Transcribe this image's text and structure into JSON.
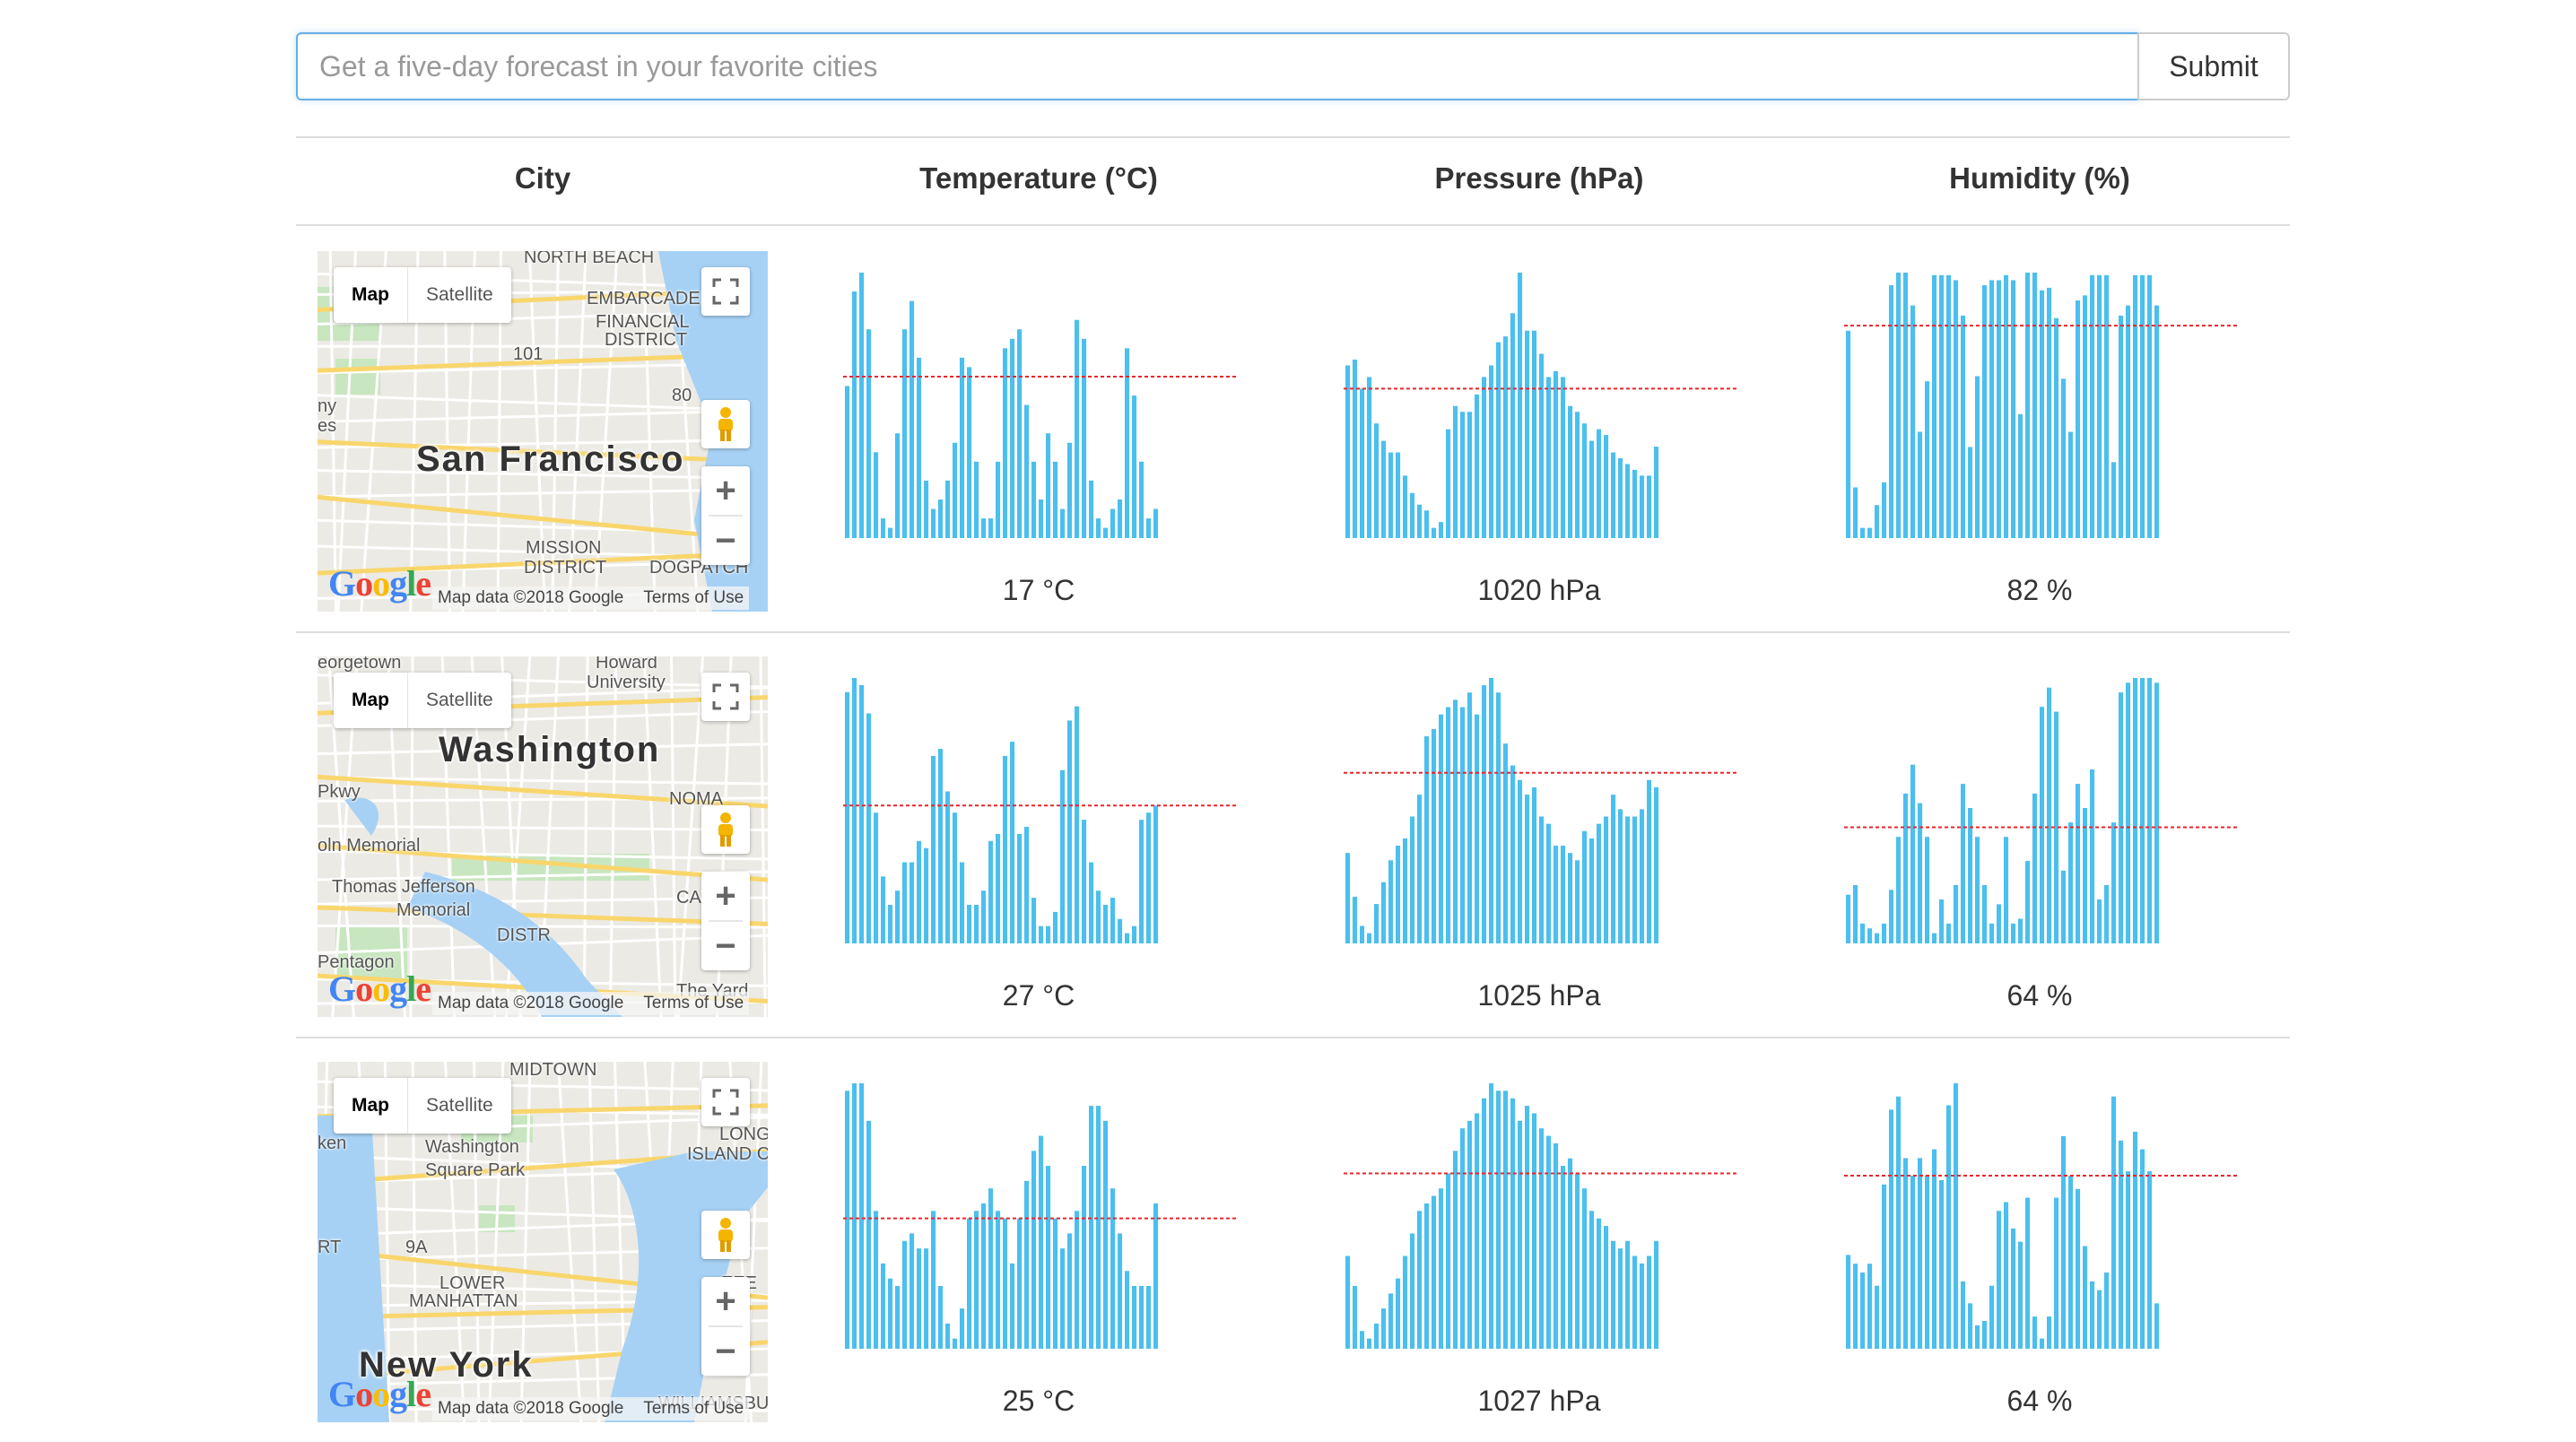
{
  "search": {
    "placeholder": "Get a five-day forecast in your favorite cities",
    "submit_label": "Submit"
  },
  "table": {
    "headers": [
      "City",
      "Temperature (°C)",
      "Pressure (hPa)",
      "Humidity (%)"
    ]
  },
  "map_controls": {
    "map_label": "Map",
    "satellite_label": "Satellite",
    "google_label": "Google",
    "map_data": "Map data ©2018 Google",
    "terms": "Terms of Use",
    "zoom_in": "+",
    "zoom_out": "−"
  },
  "colors": {
    "bar": "#4bbfee",
    "mean_line": "#e8262b",
    "divider": "#dddddd",
    "input_focus": "#66afe9"
  },
  "rows": [
    {
      "city": "San Francisco",
      "map_labels": [
        "NORTH BEACH",
        "EMBARCADERO",
        "FINANCIAL",
        "DISTRICT",
        "101",
        "80",
        "MISSION",
        "DISTRICT",
        "DOGPATCH",
        "ny",
        "es"
      ],
      "temperature": {
        "label": "17 °C",
        "mean": 17,
        "values": [
          16,
          26,
          28,
          22,
          9,
          2,
          1,
          11,
          22,
          25,
          19,
          6,
          3,
          4,
          6,
          10,
          19,
          18,
          8,
          2,
          2,
          8,
          20,
          21,
          22,
          14,
          8,
          4,
          11,
          8,
          3,
          10,
          23,
          21,
          6,
          2,
          1,
          3,
          4,
          20,
          15,
          8,
          2,
          3
        ]
      },
      "pressure": {
        "label": "1020 hPa",
        "mean": 1020,
        "values": [
          1024,
          1025,
          1020,
          1022,
          1014,
          1011,
          1009,
          1009,
          1005,
          1002,
          1000,
          999,
          996,
          997,
          1013,
          1017,
          1016,
          1016,
          1019,
          1022,
          1024,
          1028,
          1029,
          1033,
          1040,
          1030,
          1030,
          1026,
          1022,
          1023,
          1022,
          1017,
          1016,
          1014,
          1011,
          1013,
          1012,
          1009,
          1008,
          1007,
          1006,
          1005,
          1005,
          1010
        ]
      },
      "humidity": {
        "label": "82 %",
        "mean": 82,
        "values": [
          80,
          18,
          2,
          2,
          11,
          20,
          98,
          103,
          103,
          90,
          40,
          60,
          102,
          102,
          102,
          100,
          86,
          34,
          62,
          98,
          100,
          100,
          102,
          100,
          47,
          103,
          103,
          96,
          97,
          85,
          61,
          40,
          92,
          94,
          102,
          102,
          102,
          28,
          86,
          90,
          102,
          102,
          102,
          90
        ]
      }
    },
    {
      "city": "Washington",
      "map_labels": [
        "eorgetown",
        "Howard",
        "University",
        "Pkwy",
        "NOMA",
        "oln Memorial",
        "Thomas Jefferson",
        "Memorial",
        "CA",
        "Pentagon",
        "DISTR",
        "The Yard"
      ],
      "temperature": {
        "label": "27 °C",
        "mean": 27,
        "values": [
          43,
          45,
          44,
          40,
          26,
          17,
          13,
          15,
          19,
          19,
          22,
          21,
          34,
          35,
          29,
          26,
          19,
          13,
          13,
          15,
          22,
          23,
          34,
          36,
          23,
          24,
          14,
          10,
          10,
          12,
          32,
          39,
          41,
          25,
          19,
          15,
          13,
          14,
          11,
          9,
          10,
          25,
          26,
          27
        ]
      },
      "pressure": {
        "label": "1025 hPa",
        "mean": 1025,
        "values": [
          1014,
          1008,
          1004,
          1003,
          1007,
          1010,
          1013,
          1015,
          1016,
          1019,
          1022,
          1030,
          1031,
          1033,
          1034,
          1035,
          1034,
          1036,
          1033,
          1037,
          1038,
          1036,
          1029,
          1026,
          1024,
          1022,
          1023,
          1019,
          1018,
          1015,
          1015,
          1014,
          1013,
          1017,
          1016,
          1018,
          1019,
          1022,
          1020,
          1019,
          1019,
          1020,
          1024,
          1023
        ]
      },
      "humidity": {
        "label": "64 %",
        "mean": 64,
        "values": [
          50,
          52,
          44,
          43,
          42,
          44,
          51,
          62,
          71,
          77,
          69,
          62,
          42,
          49,
          44,
          52,
          73,
          68,
          62,
          52,
          44,
          48,
          62,
          44,
          45,
          57,
          71,
          89,
          93,
          88,
          55,
          65,
          73,
          68,
          76,
          49,
          52,
          65,
          92,
          94,
          95,
          95,
          95,
          94
        ]
      }
    },
    {
      "city": "New York",
      "map_labels": [
        "MIDTOWN",
        "Washington",
        "Square Park",
        "LONG",
        "ISLAND C",
        "9A",
        "LOWER",
        "MANHATTAN",
        "RT",
        "ken",
        "WILLIAMSBURG",
        "EEE"
      ],
      "temperature": {
        "label": "25 °C",
        "mean": 25,
        "values": [
          42,
          43,
          43,
          38,
          26,
          19,
          17,
          16,
          22,
          23,
          21,
          21,
          26,
          16,
          11,
          9,
          13,
          25,
          26,
          27,
          29,
          26,
          25,
          19,
          25,
          30,
          34,
          36,
          32,
          25,
          21,
          23,
          26,
          32,
          40,
          40,
          38,
          29,
          23,
          18,
          16,
          16,
          16,
          27
        ]
      },
      "pressure": {
        "label": "1027 hPa",
        "mean": 1027,
        "values": [
          1016,
          1012,
          1006,
          1005,
          1007,
          1009,
          1011,
          1013,
          1016,
          1019,
          1022,
          1023,
          1024,
          1025,
          1027,
          1030,
          1033,
          1034,
          1035,
          1037,
          1039,
          1038,
          1038,
          1037,
          1034,
          1036,
          1035,
          1033,
          1032,
          1031,
          1028,
          1029,
          1027,
          1025,
          1022,
          1021,
          1020,
          1018,
          1017,
          1018,
          1016,
          1015,
          1016,
          1018
        ]
      },
      "humidity": {
        "label": "64 %",
        "mean": 64,
        "values": [
          46,
          44,
          42,
          44,
          39,
          62,
          79,
          82,
          68,
          64,
          68,
          64,
          70,
          63,
          80,
          85,
          40,
          35,
          30,
          31,
          39,
          56,
          58,
          52,
          49,
          59,
          32,
          27,
          32,
          59,
          73,
          64,
          61,
          48,
          40,
          38,
          42,
          82,
          72,
          65,
          74,
          70,
          65,
          35
        ]
      }
    }
  ]
}
